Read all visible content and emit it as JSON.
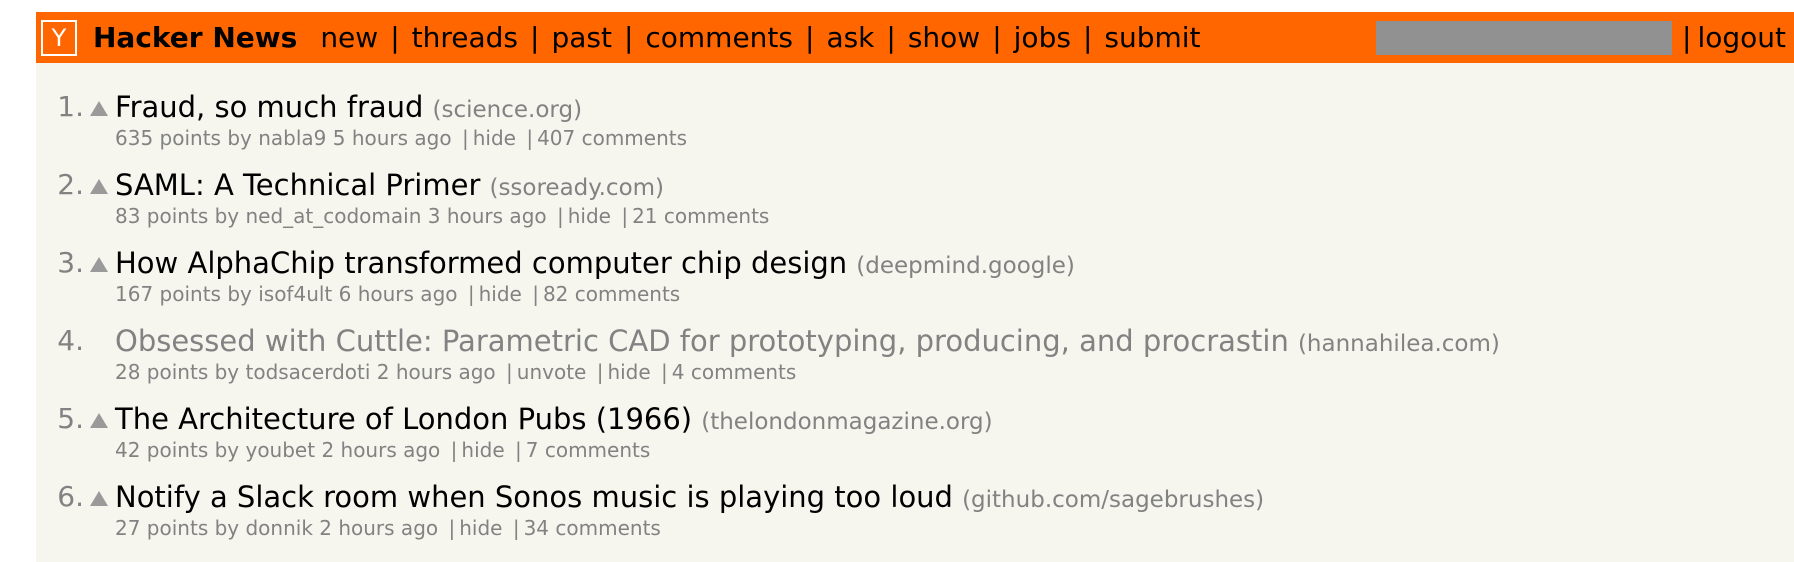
{
  "header": {
    "logo_letter": "Y",
    "site_name": "Hacker News",
    "nav": [
      "new",
      "threads",
      "past",
      "comments",
      "ask",
      "show",
      "jobs",
      "submit"
    ],
    "logout": "logout"
  },
  "colors": {
    "header_bg": "#ff6600",
    "page_bg": "#f6f6ef",
    "muted_text": "#828282"
  },
  "stories": [
    {
      "rank": "1.",
      "title": "Fraud, so much fraud",
      "site": "(science.org)",
      "points": "635 points",
      "user": "nabla9",
      "age": "5 hours ago",
      "unvote": null,
      "hide": "hide",
      "comments": "407 comments",
      "visited": false
    },
    {
      "rank": "2.",
      "title": "SAML: A Technical Primer",
      "site": "(ssoready.com)",
      "points": "83 points",
      "user": "ned_at_codomain",
      "age": "3 hours ago",
      "unvote": null,
      "hide": "hide",
      "comments": "21 comments",
      "visited": false
    },
    {
      "rank": "3.",
      "title": "How AlphaChip transformed computer chip design",
      "site": "(deepmind.google)",
      "points": "167 points",
      "user": "isof4ult",
      "age": "6 hours ago",
      "unvote": null,
      "hide": "hide",
      "comments": "82 comments",
      "visited": false
    },
    {
      "rank": "4.",
      "title": "Obsessed with Cuttle: Parametric CAD for prototyping, producing, and procrastin",
      "site": "(hannahilea.com)",
      "points": "28 points",
      "user": "todsacerdoti",
      "age": "2 hours ago",
      "unvote": "unvote",
      "hide": "hide",
      "comments": "4 comments",
      "visited": true
    },
    {
      "rank": "5.",
      "title": "The Architecture of London Pubs (1966)",
      "site": "(thelondonmagazine.org)",
      "points": "42 points",
      "user": "youbet",
      "age": "2 hours ago",
      "unvote": null,
      "hide": "hide",
      "comments": "7 comments",
      "visited": false
    },
    {
      "rank": "6.",
      "title": "Notify a Slack room when Sonos music is playing too loud",
      "site": "(github.com/sagebrushes)",
      "points": "27 points",
      "user": "donnik",
      "age": "2 hours ago",
      "unvote": null,
      "hide": "hide",
      "comments": "34 comments",
      "visited": false
    }
  ]
}
